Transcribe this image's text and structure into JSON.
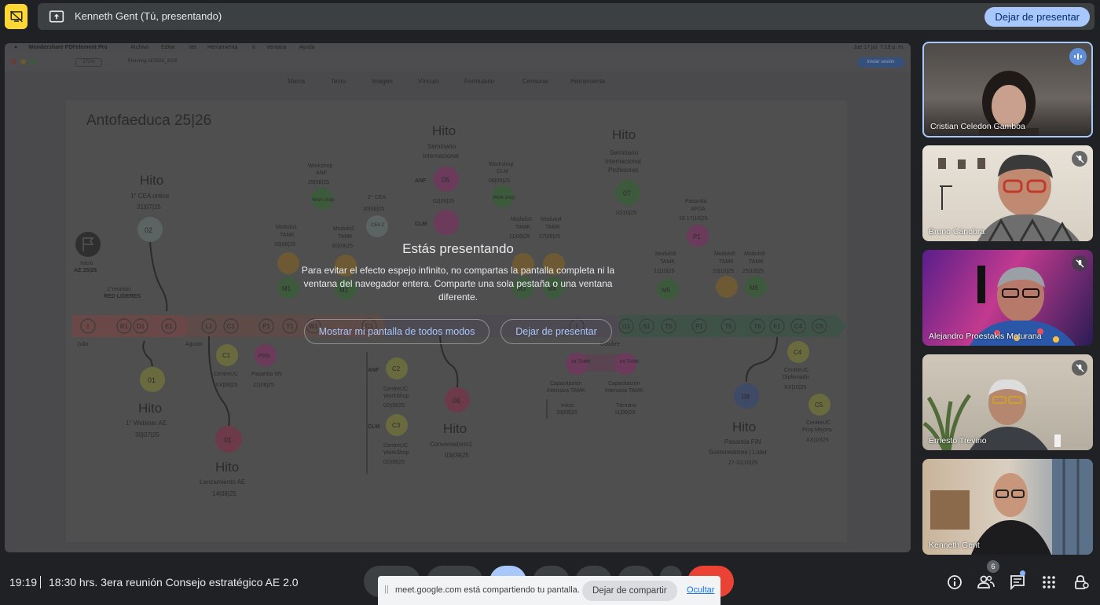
{
  "banner": {
    "presenter_text": "Kenneth Gent (Tú, presentando)",
    "stop_button": "Dejar de presentar"
  },
  "shared_screen": {
    "mac_menu": [
      "Wondershare PDFelement Pro",
      "Archivo",
      "Editar",
      "Ver",
      "Herramienta",
      "Ir",
      "Ventana",
      "Ayuda"
    ],
    "clock": "Jue 17 jul.  7:19 p. m.",
    "tab_name": "Planning AE2526_2026",
    "zoom": "172%",
    "share_pill": "Iniciar sesión",
    "tools": [
      "Marca",
      "Texto",
      "Imagen",
      "Vínculo",
      "Formulario",
      "Censurar",
      "Herramienta"
    ],
    "diagram": {
      "title": "Antofaeduca 25|26",
      "timeline": [
        "I",
        "R1",
        "D1",
        "E1",
        "L1",
        "C1",
        "P1",
        "T1",
        "W1",
        "C1",
        "I",
        "I11",
        "S1",
        "T5",
        "P1",
        "T5",
        "T6",
        "F1",
        "C4",
        "C5"
      ],
      "timeline_labels": {
        "julio": "Julio",
        "agosto": "Agosto",
        "octubre": "Octubre"
      },
      "inicio": "Inicio",
      "inicio_sub": "AE 25|26",
      "reunion": "1°reunión",
      "reunion_sub": "RED LIDERES",
      "hitos": [
        {
          "title": "Hito",
          "sub": "1° CEA online",
          "date": "31|07|25",
          "code": "02"
        },
        {
          "title": "Hito",
          "sub": "1° Webinar AE",
          "date": "30|07|25",
          "code": "01"
        },
        {
          "title": "Hito",
          "sub": "Lanzamiento AE",
          "date": "14|08|25",
          "code": "01"
        },
        {
          "title": "Hito",
          "sub": "Seminario",
          "sub2": "Internacional",
          "date": "02|09|25",
          "code": "05"
        },
        {
          "title": "Hito",
          "sub": "Conversatorio1",
          "date": "03|09|25",
          "code": "06"
        },
        {
          "title": "Hito",
          "sub": "Seminario",
          "sub2": "Internacional",
          "sub3": "Profesores",
          "date": "10|10|25",
          "code": "07"
        },
        {
          "title": "Hito",
          "sub": "Pasantía FIN",
          "sub2": "Sostenedores | Líder",
          "date": "27-31|10|25",
          "code": "08"
        }
      ],
      "workshop_anf": {
        "l1": "Workshop",
        "l2": "ANF",
        "date": "29|08|25",
        "circle": "Work shop"
      },
      "workshop_clm": {
        "l1": "Workshop",
        "l2": "CLM",
        "date": "06|09|25",
        "circle": "Work shop"
      },
      "cea2": {
        "l1": "2° CEA",
        "date": "30|08|25",
        "circle": "CEA 2"
      },
      "anf": "ANF",
      "clm": "CLM",
      "modulo1": {
        "l1": "Modulo1",
        "l2": "TAMK",
        "date": "16|08|25",
        "code": "M1"
      },
      "modulo2": {
        "l1": "Modulo2",
        "l2": "TAMK",
        "date": "30|08|25",
        "code": "M2"
      },
      "modulo3": {
        "l1": "Modulo3",
        "l2": "TAMK",
        "date": "11|09|25",
        "code": "M3"
      },
      "modulo4": {
        "l1": "Modulo4",
        "l2": "TAMK",
        "date": "27|09|25",
        "code": "M4"
      },
      "modulo5": {
        "l1": "Modulo5",
        "l2": "TAMK",
        "date": "11|10|25",
        "code": "M5"
      },
      "modulo5b": {
        "l1": "Modulo5",
        "l2": "TAMK",
        "date": "23|10|25"
      },
      "modulo6": {
        "l1": "Modulo6",
        "l2": "TAMK",
        "date": "25|10|25",
        "code": "M6"
      },
      "pasantia_afda": {
        "l1": "Pasantia",
        "l2": "AFDA",
        "date": "16 17|10|25",
        "code": "P1"
      },
      "centreuc_c1": {
        "code": "C1",
        "l1": "CentreUC",
        "date": "XX|08|25"
      },
      "pasantia_sn": {
        "code": "PSN",
        "l1": "Pasantia SN",
        "date": "21|08|25"
      },
      "centreuc_c2": {
        "code": "C2",
        "l1": "CentreUC",
        "l2": "WorkShop",
        "date": "02|09|25"
      },
      "centreuc_c3": {
        "code": "C3",
        "l1": "CentreUC",
        "l2": "WorkShop",
        "date": "01|09|25"
      },
      "centreuc_c4": {
        "code": "C4",
        "l1": "CentreUC",
        "l2": "Diplomado",
        "date": "XX|10|25"
      },
      "centreuc_c5": {
        "code": "C5",
        "l1": "CentreUC",
        "l2": "Proy.Mejora",
        "date": "XX|10|25"
      },
      "cap_inicio": {
        "circle": "Int TAMK",
        "l1": "Capacitación",
        "l2": "Intensiva TAMK",
        "l3": "Inicio",
        "date": "29|09|25"
      },
      "cap_termino": {
        "circle": "Int TAMK",
        "l1": "Capacitación",
        "l2": "Intensiva TAMK",
        "l3": "Término",
        "date": "11|09|25"
      }
    }
  },
  "overlay": {
    "title": "Estás presentando",
    "text": "Para evitar el efecto espejo infinito, no compartas la pantalla completa ni la ventana del navegador entera. Comparte una sola pestaña o una ventana diferente.",
    "show_anyway": "Mostrar mi pantalla de todos modos",
    "stop_presenting": "Dejar de presentar"
  },
  "participants": [
    {
      "name": "Cristian Celedon Gamboa",
      "status": "speaking"
    },
    {
      "name": "Bruno Cánobra",
      "status": "muted"
    },
    {
      "name": "Alejandro Proestakis Maturana",
      "status": "muted"
    },
    {
      "name": "Ernesto Trevino",
      "status": "muted"
    },
    {
      "name": "Kenneth Gent",
      "status": "self"
    }
  ],
  "bottom": {
    "time": "19:19",
    "meeting_title": "18:30 hrs. 3era reunión Consejo estratégico AE 2.0",
    "participant_count": "6"
  },
  "share_notice": {
    "text": "meet.google.com está compartiendo tu pantalla.",
    "stop_sharing": "Dejar de compartir",
    "hide": "Ocultar"
  },
  "icons": {
    "top_left": "present-off-icon",
    "banner": "present-to-all-icon",
    "info": "info-icon",
    "people": "people-icon",
    "chat": "chat-icon",
    "activities": "apps-grid-icon",
    "host_controls": "lock-person-icon"
  },
  "colors": {
    "accent": "#a8c7fa",
    "top_icon": "#fdd835",
    "background": "#202124",
    "end_call": "#ea4335"
  }
}
